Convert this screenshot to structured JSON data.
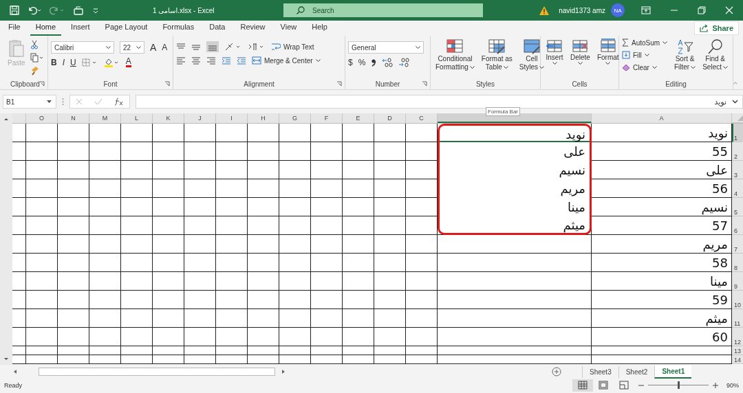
{
  "window": {
    "title": "اسامی 1.xlsx - Excel",
    "search_placeholder": "Search",
    "warning": true,
    "user": "navid1373 amz",
    "avatar": "NA"
  },
  "tabs": [
    {
      "label": "File",
      "selected": false
    },
    {
      "label": "Home",
      "selected": true
    },
    {
      "label": "Insert",
      "selected": false
    },
    {
      "label": "Page Layout",
      "selected": false
    },
    {
      "label": "Formulas",
      "selected": false
    },
    {
      "label": "Data",
      "selected": false
    },
    {
      "label": "Review",
      "selected": false
    },
    {
      "label": "View",
      "selected": false
    },
    {
      "label": "Help",
      "selected": false
    }
  ],
  "share": "Share",
  "ribbon": {
    "clipboard": {
      "label": "Clipboard",
      "paste": "Paste",
      "paste_disabled": true
    },
    "font": {
      "label": "Font",
      "family": "Calibri",
      "size": "22",
      "grow": "A",
      "shrink": "A",
      "bold": "B",
      "italic": "I",
      "underline": "U",
      "color_letter": "A"
    },
    "alignment": {
      "label": "Alignment",
      "wrap": "Wrap Text",
      "merge": "Merge & Center"
    },
    "number": {
      "label": "Number",
      "format": "General",
      "currency": "$",
      "percent": "%"
    },
    "styles": {
      "label": "Styles",
      "buttons": [
        {
          "line1": "Conditional",
          "line2": "Formatting",
          "kind": "conditional"
        },
        {
          "line1": "Format as",
          "line2": "Table",
          "kind": "table"
        },
        {
          "line1": "Cell",
          "line2": "Styles",
          "kind": "cellstyles"
        }
      ]
    },
    "cells": {
      "label": "Cells",
      "buttons": [
        {
          "label": "Insert",
          "kind": "insert"
        },
        {
          "label": "Delete",
          "kind": "delete"
        },
        {
          "label": "Format",
          "kind": "format"
        }
      ]
    },
    "editing": {
      "label": "Editing",
      "autosum": "AutoSum",
      "fill": "Fill",
      "clear": "Clear",
      "sort": [
        "Sort &",
        "Filter"
      ],
      "find": [
        "Find &",
        "Select"
      ]
    }
  },
  "name_box": "B1",
  "formula": "نوید",
  "tooltip": "Formula Bar",
  "columns": [
    {
      "kind": "narrow"
    },
    {
      "label": "O",
      "kind": "narrow",
      "selected": false
    },
    {
      "label": "N",
      "kind": "narrow",
      "selected": false
    },
    {
      "label": "M",
      "kind": "narrow",
      "selected": false
    },
    {
      "label": "L",
      "kind": "narrow",
      "selected": false
    },
    {
      "label": "K",
      "kind": "narrow",
      "selected": false
    },
    {
      "label": "J",
      "kind": "narrow",
      "selected": false
    },
    {
      "label": "I",
      "kind": "narrow",
      "selected": false
    },
    {
      "label": "H",
      "kind": "narrow",
      "selected": false
    },
    {
      "label": "G",
      "kind": "narrow",
      "selected": false
    },
    {
      "label": "F",
      "kind": "narrow",
      "selected": false
    },
    {
      "label": "E",
      "kind": "narrow",
      "selected": false
    },
    {
      "label": "D",
      "kind": "narrow",
      "selected": false
    },
    {
      "label": "C",
      "kind": "narrow",
      "selected": false
    },
    {
      "kind": "b",
      "selected": true
    },
    {
      "label": "A",
      "kind": "a",
      "selected": false
    }
  ],
  "rows": [
    {
      "number": "1",
      "b": "نوید",
      "a": "نوید",
      "selected": true,
      "circled": true
    },
    {
      "number": "2",
      "b": "علی",
      "a": "55",
      "selected": false,
      "circled": true
    },
    {
      "number": "3",
      "b": "نسیم",
      "a": "علی",
      "selected": false,
      "circled": true
    },
    {
      "number": "4",
      "b": "مریم",
      "a": "56",
      "selected": false,
      "circled": true
    },
    {
      "number": "5",
      "b": "مینا",
      "a": "نسیم",
      "selected": false,
      "circled": true
    },
    {
      "number": "6",
      "b": "میثم",
      "a": "57",
      "selected": false,
      "circled": true
    },
    {
      "number": "7",
      "a": "مریم",
      "selected": false
    },
    {
      "number": "8",
      "a": "58",
      "selected": false
    },
    {
      "number": "9",
      "a": "مینا",
      "selected": false
    },
    {
      "number": "10",
      "a": "59",
      "selected": false
    },
    {
      "number": "11",
      "a": "میثم",
      "selected": false
    },
    {
      "number": "12",
      "a": "60",
      "selected": false
    },
    {
      "number": "13",
      "selected": false
    },
    {
      "number": "14",
      "selected": false
    }
  ],
  "sheets": [
    {
      "label": "Sheet3",
      "selected": false
    },
    {
      "label": "Sheet2",
      "selected": false
    },
    {
      "label": "Sheet1",
      "selected": true
    }
  ],
  "status": {
    "text": "Ready",
    "zoom": "90%",
    "level": 0.5
  }
}
